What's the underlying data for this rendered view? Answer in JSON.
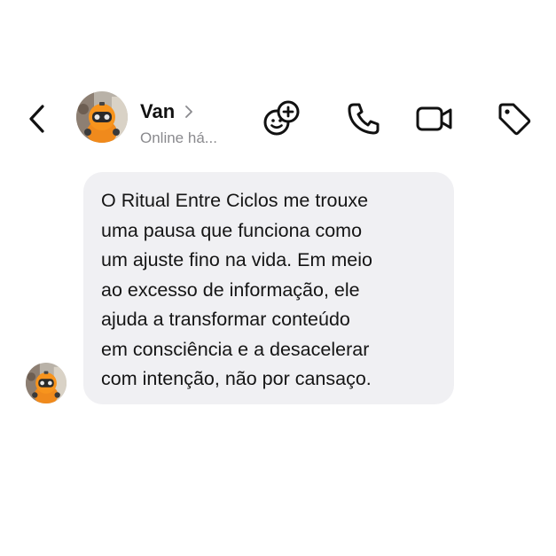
{
  "header": {
    "contact_name": "Van",
    "status": "Online há...",
    "icons": {
      "back": "chevron-left-icon",
      "name_chevron": "chevron-right-icon",
      "stickers": "stickers-icon",
      "call": "phone-icon",
      "video": "video-camera-icon",
      "tag": "tag-icon"
    }
  },
  "message": {
    "lines": [
      "O Ritual Entre Ciclos me trouxe",
      "uma pausa que funciona como",
      "um ajuste fino na vida. Em meio",
      "ao excesso de informação, ele",
      "ajuda a transformar conteúdo",
      "em consciência e a desacelerar",
      "com intenção, não por cansaço."
    ]
  },
  "colors": {
    "background": "#ffffff",
    "bubble": "#f0f0f3",
    "text": "#111111",
    "secondary_text": "#8a8a8e",
    "avatar_accent": "#f08a1c"
  }
}
